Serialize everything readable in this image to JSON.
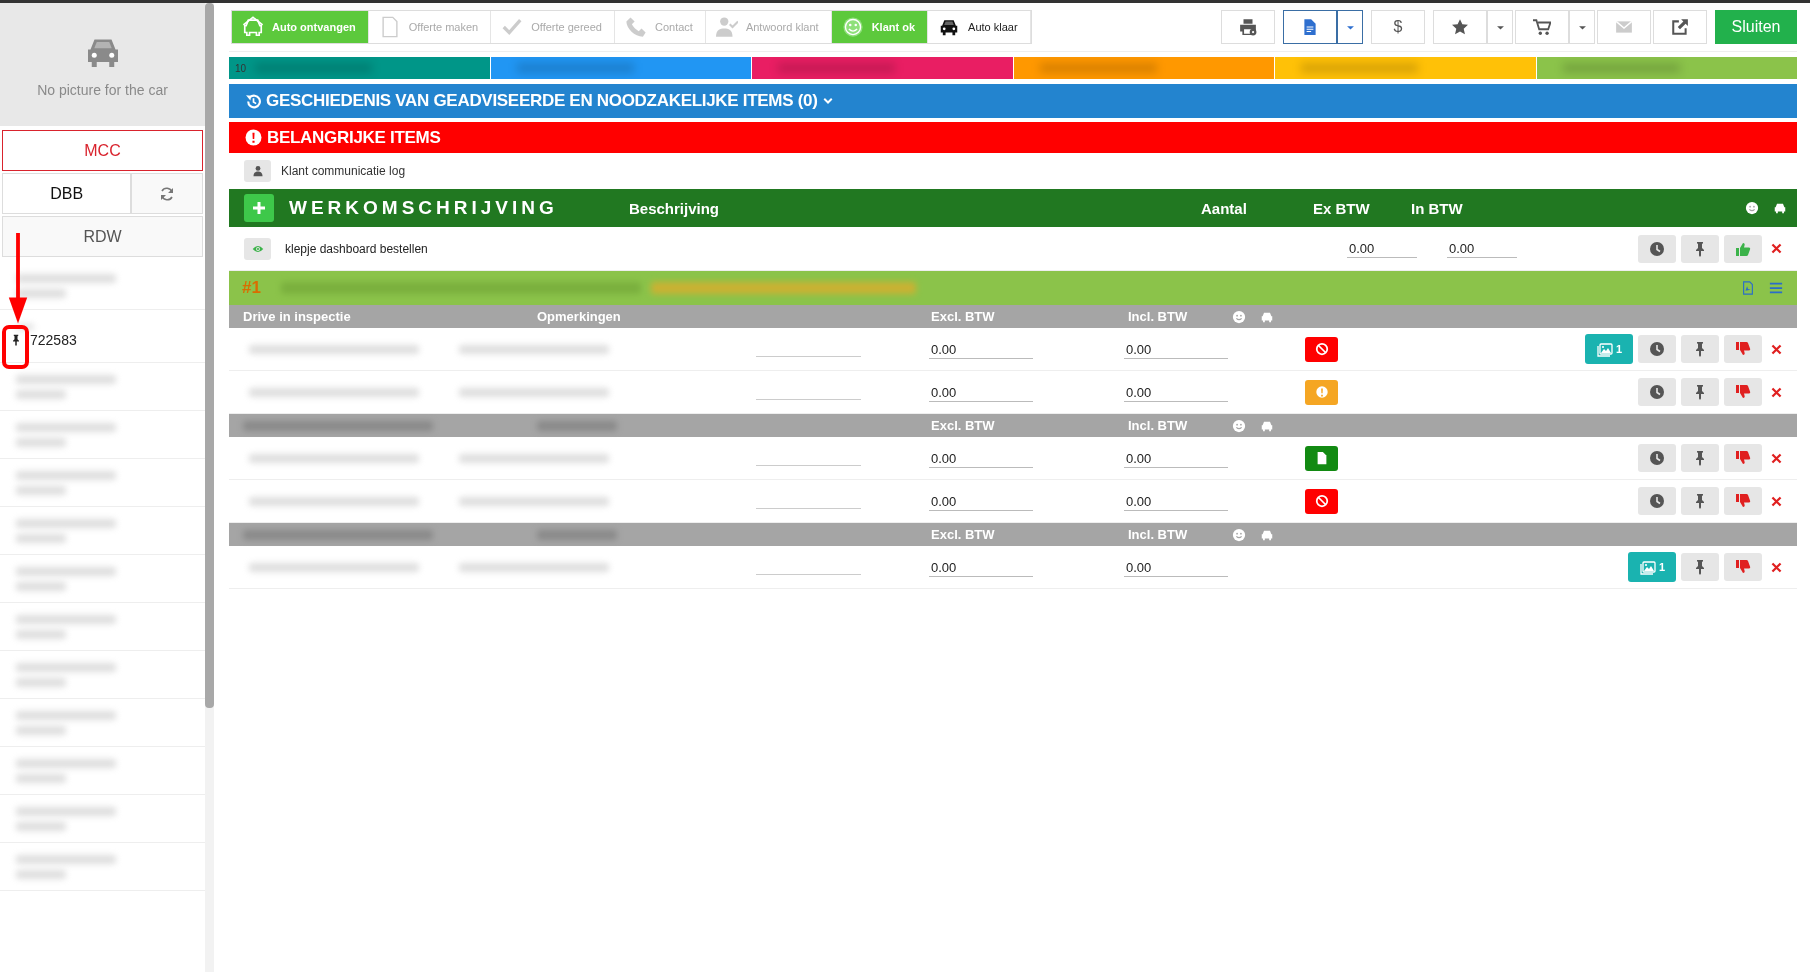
{
  "sidebar": {
    "photo_caption": "No picture for the car",
    "buttons": [
      {
        "label": "MCC",
        "kind": "alert"
      },
      {
        "label": "DBB",
        "kind": "split"
      },
      {
        "label": "RDW",
        "kind": "plain"
      }
    ],
    "fields": [
      {
        "kind": "redacted"
      },
      {
        "kind": "pinned",
        "value": "722583"
      },
      {
        "kind": "redacted"
      },
      {
        "kind": "redacted"
      },
      {
        "kind": "redacted"
      },
      {
        "kind": "redacted"
      },
      {
        "kind": "redacted"
      },
      {
        "kind": "redacted"
      },
      {
        "kind": "redacted"
      },
      {
        "kind": "redacted"
      },
      {
        "kind": "redacted"
      },
      {
        "kind": "redacted"
      },
      {
        "kind": "redacted"
      }
    ]
  },
  "annotation": {
    "kind": "arrow-box"
  },
  "steps": [
    {
      "label": "Auto ontvangen",
      "done": true,
      "current": false
    },
    {
      "label": "Offerte maken",
      "done": false,
      "current": false
    },
    {
      "label": "Offerte gereed",
      "done": false,
      "current": false
    },
    {
      "label": "Contact",
      "done": false,
      "current": false
    },
    {
      "label": "Antwoord klant",
      "done": false,
      "current": false
    },
    {
      "label": "Klant ok",
      "done": true,
      "current": false
    },
    {
      "label": "Auto klaar",
      "done": false,
      "current": true
    }
  ],
  "toolbar": [
    {
      "kind": "print"
    },
    {
      "kind": "document",
      "dropdown": true,
      "selected": true
    },
    {
      "kind": "text",
      "label": "$"
    },
    {
      "kind": "star",
      "dropdown": true
    },
    {
      "kind": "cart",
      "dropdown": true
    },
    {
      "kind": "mail",
      "disabled": true
    },
    {
      "kind": "external"
    },
    {
      "kind": "primary",
      "label": "Sluiten"
    }
  ],
  "progress_segments": [
    {
      "color": "#009688",
      "label": "10"
    },
    {
      "color": "#2196f3"
    },
    {
      "color": "#e91e63"
    },
    {
      "color": "#ff9800"
    },
    {
      "color": "#ffc107"
    },
    {
      "color": "#8bc34a"
    }
  ],
  "history": {
    "title": "GESCHIEDENIS VAN GEADVISEERDE EN NOODZAKELIJKE ITEMS (0)",
    "expanded": false
  },
  "important": {
    "title": "BELANGRIJKE ITEMS",
    "items": [
      "Klant communicatie log"
    ]
  },
  "work": {
    "title": "WERKOMSCHRIJVING",
    "columns": [
      "Beschrijving",
      "Aantal",
      "Ex BTW",
      "In BTW"
    ],
    "tasks": [
      {
        "description": "klepje dashboard bestellen",
        "ex_btw": "0.00",
        "in_btw": "0.00",
        "approved": true
      }
    ]
  },
  "inspection": {
    "number": "#1",
    "redacted": true,
    "groups": [
      {
        "title": "Drive in inspectie",
        "remarks": "Opmerkingen",
        "excl": "Excl. BTW",
        "incl": "Incl. BTW",
        "rows": [
          {
            "excl": "0.00",
            "incl": "0.00",
            "kind": "danger",
            "photo_count": "1",
            "clock": true
          },
          {
            "excl": "0.00",
            "incl": "0.00",
            "kind": "warning",
            "clock": true
          }
        ]
      },
      {
        "excl": "Excl. BTW",
        "incl": "Incl. BTW",
        "rows": [
          {
            "excl": "0.00",
            "incl": "0.00",
            "kind": "ok",
            "clock": true
          },
          {
            "excl": "0.00",
            "incl": "0.00",
            "kind": "danger",
            "clock": true
          }
        ]
      },
      {
        "excl": "Excl. BTW",
        "incl": "Incl. BTW",
        "rows": [
          {
            "excl": "0.00",
            "incl": "0.00",
            "photo_count": "1",
            "clock": false
          }
        ]
      }
    ]
  }
}
